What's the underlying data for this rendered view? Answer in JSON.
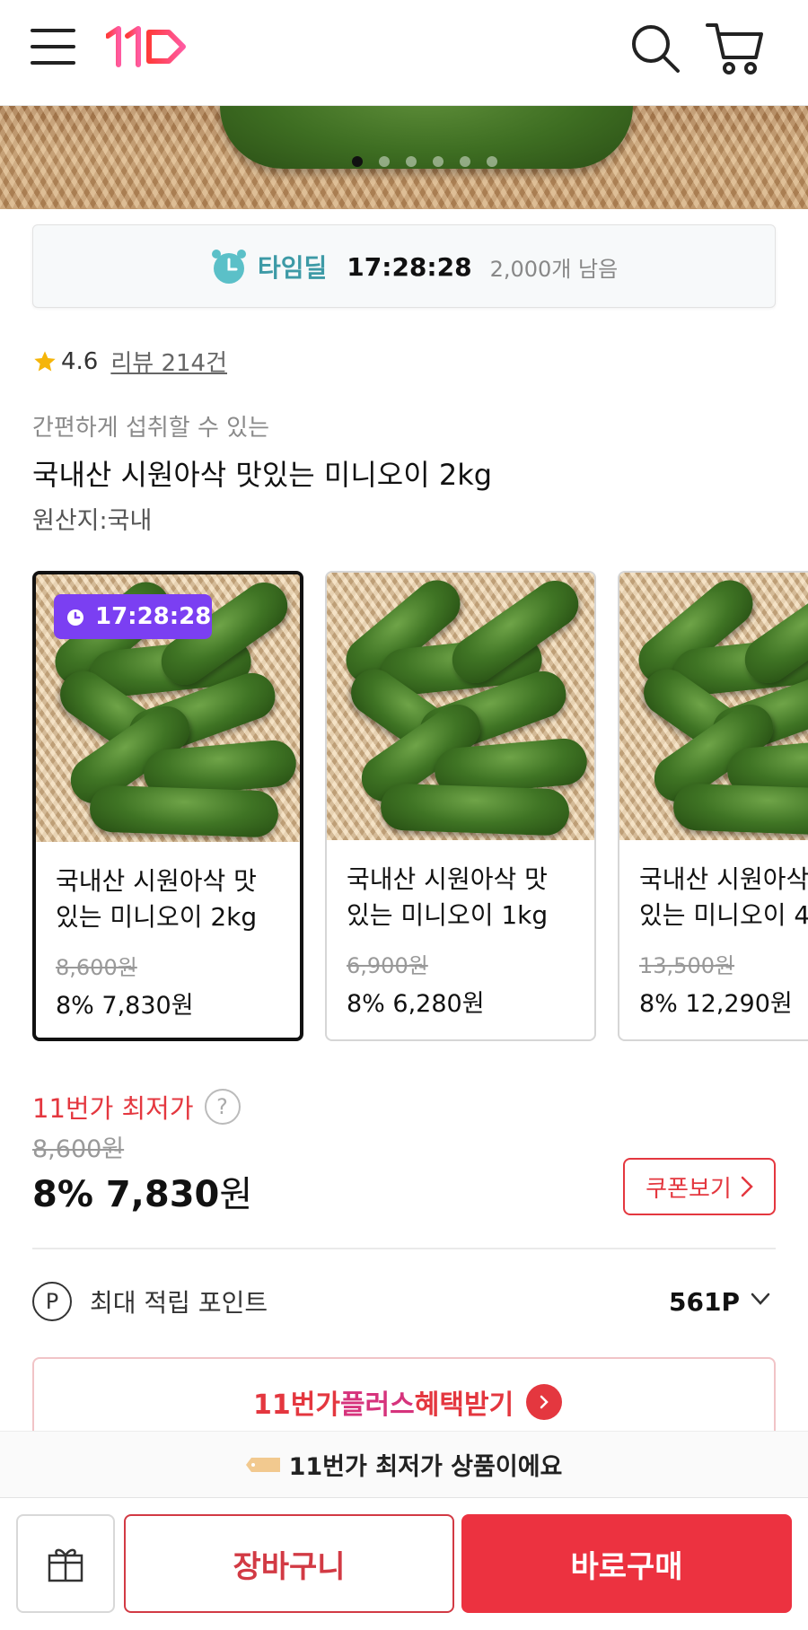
{
  "header": {
    "logo_text": "11",
    "icons": {
      "menu": "hamburger-menu-icon",
      "search": "search-icon",
      "cart": "cart-icon"
    }
  },
  "hero": {
    "slide_count": 6,
    "active_slide": 1
  },
  "time_deal": {
    "label": "타임딜",
    "countdown": "17:28:28",
    "remaining": "2,000개 남음",
    "icon": "alarm-clock-icon"
  },
  "rating": {
    "score": "4.6",
    "reviews": "리뷰 214건"
  },
  "product": {
    "subtitle": "간편하게 섭취할 수 있는",
    "title": "국내산 시원아삭 맛있는 미니오이 2kg",
    "origin": "원산지:국내"
  },
  "options": [
    {
      "name": "국내산 시원아삭 맛\n있는 미니오이 2kg",
      "original_price": "8,600원",
      "price": "8% 7,830원",
      "timer": "17:28:28",
      "selected": true
    },
    {
      "name": "국내산 시원아삭 맛\n있는 미니오이 1kg",
      "original_price": "6,900원",
      "price": "8% 6,280원",
      "selected": false
    },
    {
      "name": "국내산 시원아삭 맛\n있는 미니오이 4",
      "original_price": "13,500원",
      "price": "8% 12,290원",
      "selected": false
    }
  ],
  "pricing": {
    "lowest_label": "11번가 최저가",
    "help": "?",
    "original_price": "8,600원",
    "discount_price": "8% 7,830",
    "unit": "원",
    "coupon_button": "쿠폰보기"
  },
  "points": {
    "icon_letter": "P",
    "label": "최대 적립 포인트",
    "value": "561P"
  },
  "plus_banner": {
    "part1": "11번가",
    "part2": "플러스",
    "part3": " 혜택받기"
  },
  "bottom": {
    "lowest_notice": "11번가 최저가 상품이에요",
    "cart_button": "장바구니",
    "buy_button": "바로구매"
  },
  "colors": {
    "accent_red": "#e4373f",
    "buy_red": "#ec3240",
    "timer_purple": "#7b3ff2",
    "timedeal_teal": "#3d9aa6"
  }
}
